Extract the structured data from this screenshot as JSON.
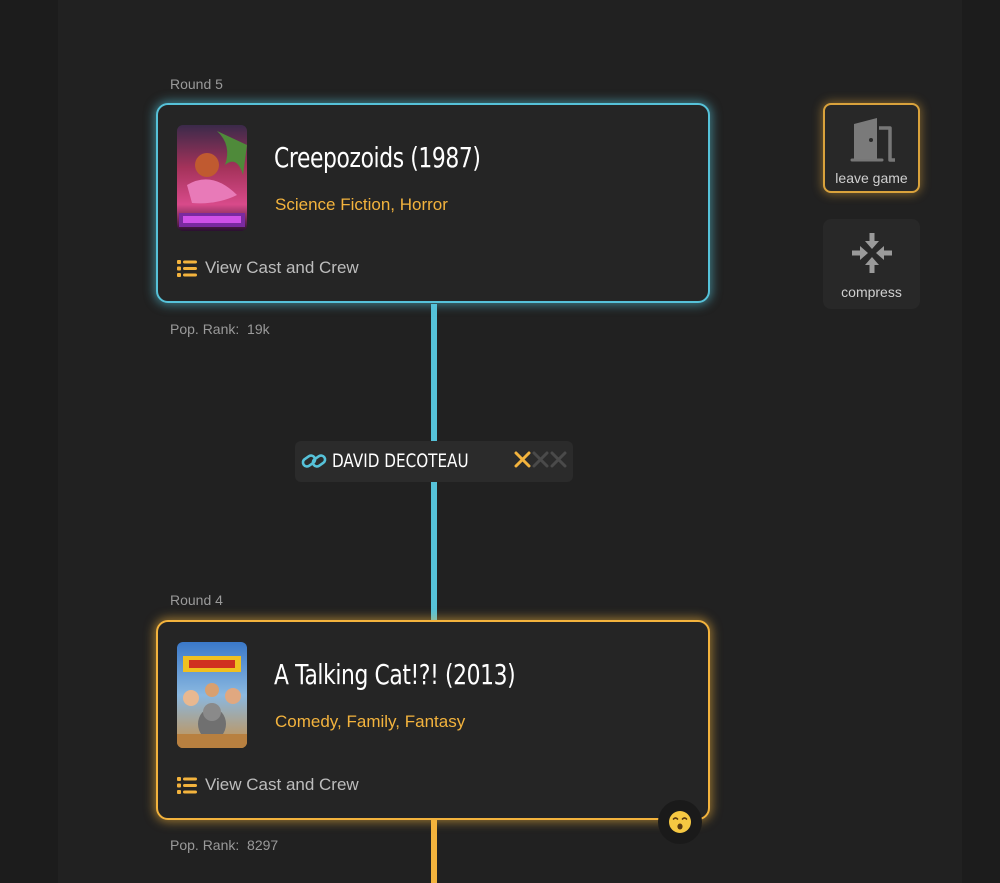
{
  "rounds": [
    {
      "label": "Round 5",
      "title": "Creepozoids (1987)",
      "genres": "Science Fiction, Horror",
      "cast_link": "View Cast and Crew",
      "pop_rank": "Pop. Rank:  19k",
      "accent": "#56c2d9"
    },
    {
      "label": "Round 4",
      "title": "A Talking Cat!?! (2013)",
      "genres": "Comedy, Family, Fantasy",
      "cast_link": "View Cast and Crew",
      "pop_rank": "Pop. Rank:  8297",
      "accent": "#f3b33d"
    }
  ],
  "connection": {
    "name": "DAVID DECOTEAU",
    "icon": "link-icon",
    "strikes_used": 1,
    "strikes_total": 3
  },
  "sidebar": {
    "leave": {
      "label": "leave game",
      "icon": "door-icon"
    },
    "compress": {
      "label": "compress",
      "icon": "compress-arrows-icon"
    }
  },
  "reaction": {
    "icon": "emoji-face-icon"
  },
  "colors": {
    "blue": "#56c2d9",
    "gold": "#f3b33d",
    "background": "#212121"
  }
}
